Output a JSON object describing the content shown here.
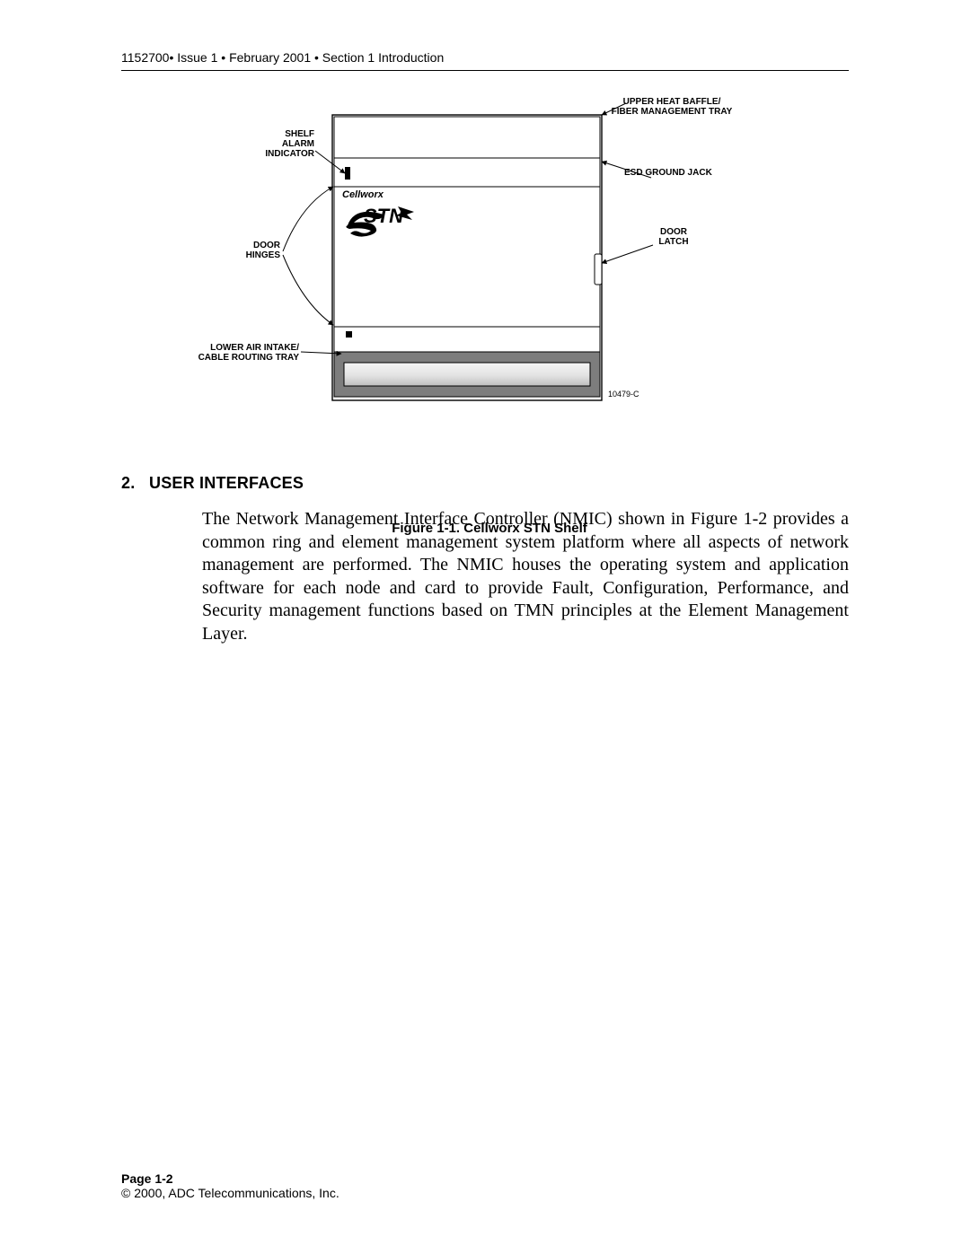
{
  "header": {
    "text": "1152700• Issue 1 • February 2001 • Section 1 Introduction"
  },
  "figure": {
    "caption": "Figure 1-1.  Cellworx STN Shelf",
    "drawing_id": "10479-C",
    "logo_top": "Cellworx",
    "logo_stn": "STN",
    "labels": {
      "upper_baffle": "UPPER HEAT BAFFLE/\nFIBER MANAGEMENT TRAY",
      "shelf_alarm": "SHELF\nALARM\nINDICATOR",
      "esd_jack": "ESD GROUND JACK",
      "door_latch": "DOOR\nLATCH",
      "door_hinges": "DOOR\nHINGES",
      "lower_intake": "LOWER AIR INTAKE/\nCABLE ROUTING TRAY"
    }
  },
  "section": {
    "number": "2.",
    "title": "USER INTERFACES",
    "body": "The Network Management Interface Controller (NMIC) shown in Figure 1-2 provides a common ring and element management system platform where all aspects of network management are performed. The NMIC houses the operating system and application software for each node and card to provide Fault, Configuration, Performance, and Security management functions based on TMN principles at the Element Management Layer."
  },
  "footer": {
    "page": "Page 1-2",
    "copyright": "© 2000, ADC Telecommunications, Inc."
  }
}
